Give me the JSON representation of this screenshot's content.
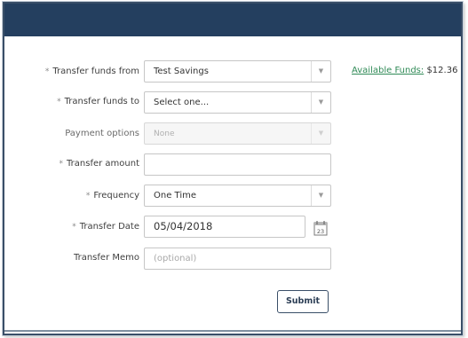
{
  "form": {
    "transfer_from": {
      "label": "Transfer funds from",
      "required": "*",
      "value": "Test Savings"
    },
    "transfer_to": {
      "label": "Transfer funds to",
      "required": "*",
      "value": "Select one..."
    },
    "payment_options": {
      "label": "Payment options",
      "value": "None"
    },
    "transfer_amount": {
      "label": "Transfer amount",
      "required": "*",
      "value": ""
    },
    "frequency": {
      "label": "Frequency",
      "required": "*",
      "value": "One Time"
    },
    "transfer_date": {
      "label": "Transfer Date",
      "required": "*",
      "value": "05/04/2018",
      "calendar_day": "23"
    },
    "memo": {
      "label": "Transfer Memo",
      "placeholder": "(optional)"
    },
    "submit_label": "Submit"
  },
  "funds": {
    "link_text": "Available Funds:",
    "amount": "$12.36"
  },
  "colors": {
    "header": "#243f5f",
    "link": "#2f8a56"
  },
  "icons": {
    "select_arrow": "chevron-down-icon",
    "calendar": "calendar-icon"
  }
}
